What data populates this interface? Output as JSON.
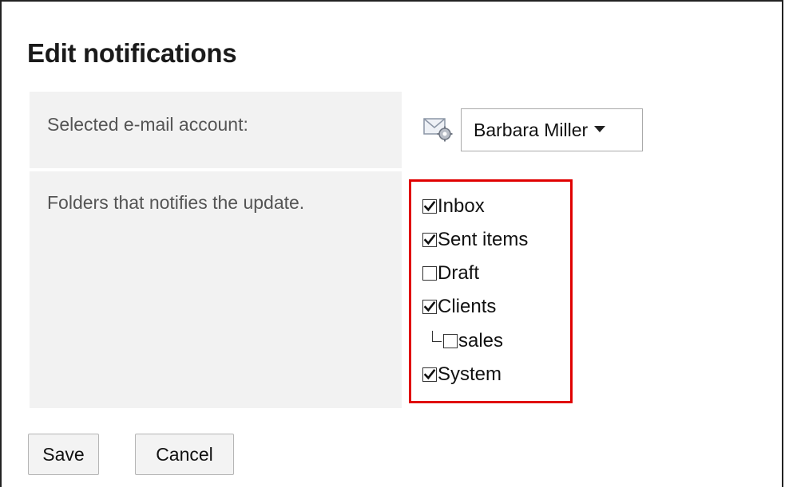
{
  "title": "Edit notifications",
  "account_row": {
    "label": "Selected e-mail account:",
    "icon": "mail-settings-icon",
    "selected_account": "Barbara Miller"
  },
  "folders_row": {
    "label": "Folders that notifies the update.",
    "highlight_color": "#e00000",
    "folders": [
      {
        "name": "Inbox",
        "checked": true,
        "level": 0
      },
      {
        "name": "Sent items",
        "checked": true,
        "level": 0
      },
      {
        "name": "Draft",
        "checked": false,
        "level": 0
      },
      {
        "name": "Clients",
        "checked": true,
        "level": 0
      },
      {
        "name": "sales",
        "checked": false,
        "level": 1
      },
      {
        "name": "System",
        "checked": true,
        "level": 0
      }
    ]
  },
  "actions": {
    "save_label": "Save",
    "cancel_label": "Cancel"
  }
}
